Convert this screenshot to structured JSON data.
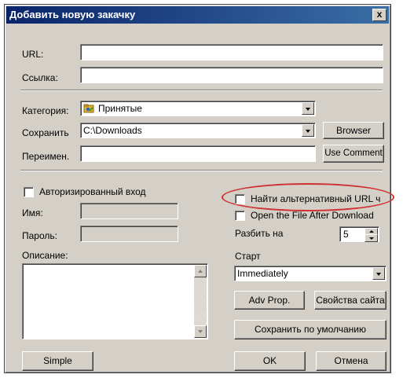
{
  "window": {
    "title": "Добавить новую закачку",
    "close_label": "x"
  },
  "url": {
    "label": "URL:",
    "value": ""
  },
  "link": {
    "label": "Ссылка:",
    "value": ""
  },
  "category": {
    "label": "Категория:",
    "value": "Принятые",
    "icon": "folder-category-icon"
  },
  "save_to": {
    "label": "Сохранить",
    "value": "C:\\Downloads",
    "browse_label": "Browser"
  },
  "rename": {
    "label": "Переимен.",
    "value": "",
    "use_comment_label": "Use Comment"
  },
  "auth": {
    "checkbox_label": "Авторизированный вход",
    "checked": false,
    "user_label": "Имя:",
    "user_value": "",
    "password_label": "Пароль:",
    "password_value": ""
  },
  "description": {
    "label": "Описание:",
    "value": ""
  },
  "options": {
    "find_alt_url_label": "Найти альтернативный URL ч",
    "find_alt_url_checked": false,
    "open_after_download_label": "Open the File After Download",
    "open_after_download_checked": false,
    "split_label": "Разбить на",
    "split_value": "5",
    "start_label": "Старт",
    "start_value": "Immediately",
    "highlight_color": "#d03030"
  },
  "buttons": {
    "adv_prop": "Adv Prop.",
    "site_props": "Свойства сайта",
    "save_default": "Сохранить по умолчанию",
    "simple": "Simple",
    "ok": "OK",
    "cancel": "Отмена"
  }
}
